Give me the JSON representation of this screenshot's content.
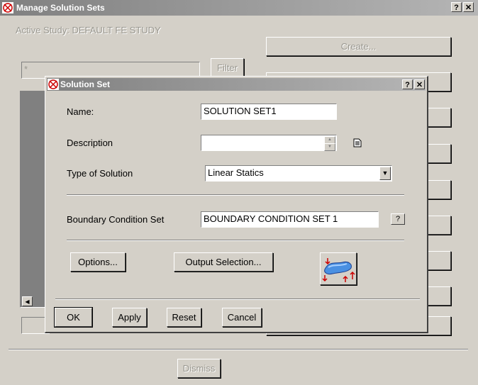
{
  "main_window": {
    "title": "Manage Solution Sets",
    "active_study": "Active Study: DEFAULT FE STUDY",
    "filter_value": "*",
    "filter_button": "Filter",
    "create_button": "Create...",
    "dismiss_button": "Dismiss",
    "help_glyph": "?",
    "close_glyph": "✕"
  },
  "dialog": {
    "title": "Solution Set",
    "name_label": "Name:",
    "name_value": "SOLUTION SET1",
    "description_label": "Description",
    "description_value": "",
    "type_label": "Type of Solution",
    "type_value": "Linear Statics",
    "bc_label": "Boundary Condition Set",
    "bc_value": "BOUNDARY CONDITION SET 1",
    "bc_help": "?",
    "options_button": "Options...",
    "output_button": "Output Selection...",
    "ok_button": "OK",
    "apply_button": "Apply",
    "reset_button": "Reset",
    "cancel_button": "Cancel",
    "help_glyph": "?",
    "close_glyph": "✕"
  },
  "icons": {
    "window_icon": "app-icon",
    "notes_icon": "document-icon",
    "model_icon": "boundary-model-icon",
    "dropdown_icon": "chevron-down-icon"
  },
  "colors": {
    "title_inactive": "#808080",
    "title_active": "#0a246a",
    "face": "#d4d0c8"
  }
}
